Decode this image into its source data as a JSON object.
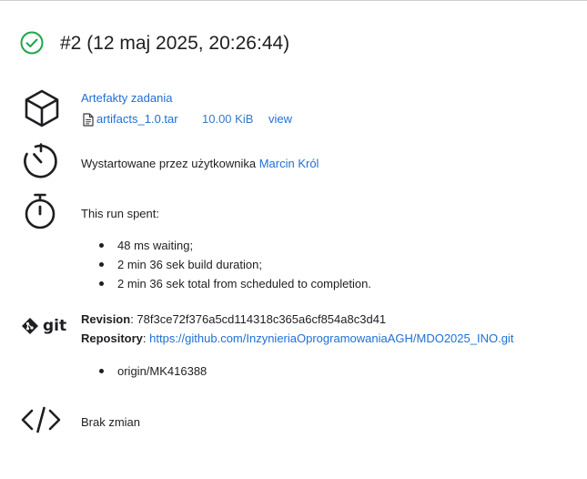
{
  "build": {
    "title": "#2 (12 maj 2025, 20:26:44)",
    "status_icon": "check-circle-icon",
    "status_color": "#1ea64b"
  },
  "artifacts": {
    "heading": "Artefakty zadania",
    "file_name": "artifacts_1.0.tar",
    "file_size": "10.00 KiB",
    "view_label": "view"
  },
  "started": {
    "text": "Wystartowane przez użytkownika",
    "user": "Marcin Król"
  },
  "timing": {
    "heading": "This run spent:",
    "items": [
      "48 ms waiting;",
      "2 min 36 sek build duration;",
      "2 min 36 sek total from scheduled to completion."
    ]
  },
  "git": {
    "logo_text": "git",
    "revision_label": "Revision",
    "revision_value": "78f3ce72f376a5cd114318c365a6cf854a8c3d41",
    "repository_label": "Repository",
    "repository_url": "https://github.com/InzynieriaOprogramowaniaAGH/MDO2025_INO.git",
    "branches": [
      "origin/MK416388"
    ]
  },
  "changes": {
    "text": "Brak zmian"
  },
  "colors": {
    "link": "#1f6fd6",
    "text": "#1f1f23",
    "success": "#1ea64b"
  }
}
